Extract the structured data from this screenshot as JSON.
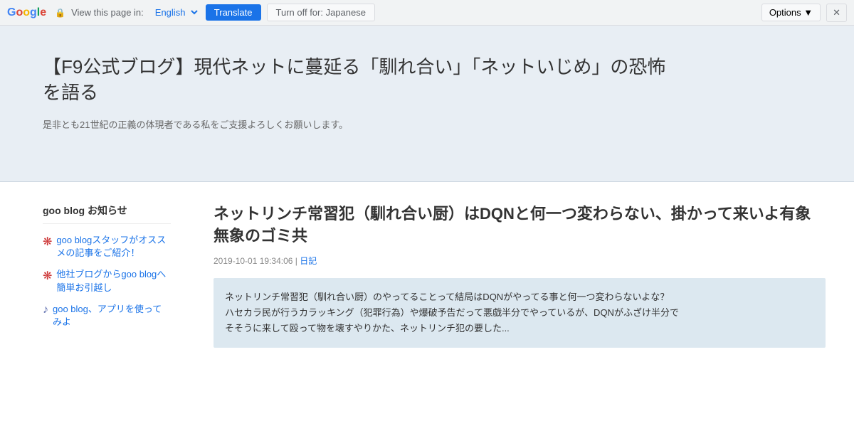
{
  "translate_bar": {
    "google_logo": "Google",
    "lock_label": "🔒",
    "view_text": "View this page in:",
    "language": "English",
    "translate_btn": "Translate",
    "turnoff_btn": "Turn off for: Japanese",
    "options_btn": "Options ▼",
    "close_btn": "✕"
  },
  "site": {
    "title": "【F9公式ブログ】現代ネットに蔓延る「馴れ合い」「ネットいじめ」の恐怖を語る",
    "subtitle": "是非とも21世紀の正義の体現者である私をご支援よろしくお願いします。"
  },
  "sidebar": {
    "title": "goo blog お知らせ",
    "items": [
      {
        "icon": "❋",
        "text": "goo blogスタッフがオススメの記事をご紹介！",
        "color": "#cc0000"
      },
      {
        "icon": "❋",
        "text": "他社ブログからgoo blogへ簡単お引越し",
        "color": "#cc0000"
      },
      {
        "icon": "♪",
        "text": "goo blog、アプリを使ってみよ",
        "color": "#cc0000"
      }
    ]
  },
  "post": {
    "title": "ネットリンチ常習犯（馴れ合い厨）はDQNと何一つ変わらない、掛かって来いよ有象無象のゴミ共",
    "date": "2019-10-01 19:34:06",
    "category": "日記",
    "body_lines": [
      "ネットリンチ常習犯（馴れ合い厨）のやってることって結局はDQNがやってる事と何一つ変わらないよな？",
      "ハセカラ民が行うカラッキング（犯罪行為）や爆破予告だって悪戯半分でやっているが、DQNがふざけ半分で",
      "そそうに来して殴って物を壊すやりかた、ネットリンチ犯の要した..."
    ]
  }
}
